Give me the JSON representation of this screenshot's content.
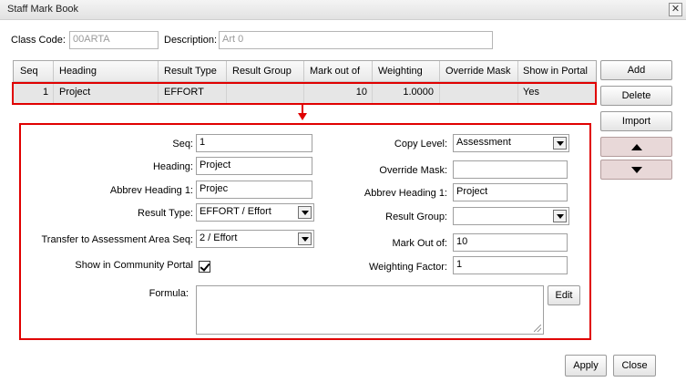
{
  "window": {
    "title": "Staff Mark Book",
    "close_glyph": "✕"
  },
  "header": {
    "class_code_label": "Class Code:",
    "class_code_value": "00ARTA",
    "description_label": "Description:",
    "description_value": "Art 0"
  },
  "grid": {
    "columns": [
      "Seq",
      "Heading",
      "Result Type",
      "Result Group",
      "Mark out of",
      "Weighting",
      "Override Mask",
      "Show in Portal"
    ],
    "rows": [
      {
        "seq": "1",
        "heading": "Project",
        "result_type": "EFFORT",
        "result_group": "",
        "mark_out_of": "10",
        "weighting": "1.0000",
        "override_mask": "",
        "show_in_portal": "Yes"
      }
    ]
  },
  "side_buttons": {
    "add": "Add",
    "delete": "Delete",
    "import": "Import",
    "move_up_icon": "up-arrow-icon",
    "move_down_icon": "down-arrow-icon"
  },
  "form": {
    "seq_label": "Seq:",
    "seq_value": "1",
    "heading_label": "Heading:",
    "heading_value": "Project",
    "abbrev_label": "Abbrev Heading 1:",
    "abbrev_value": "Projec",
    "result_type_label": "Result Type:",
    "result_type_value": "EFFORT / Effort",
    "transfer_label": "Transfer to Assessment Area Seq:",
    "transfer_value": "2 / Effort",
    "portal_label": "Show in Community Portal",
    "portal_checked": true,
    "formula_label": "Formula:",
    "formula_value": "",
    "edit_label": "Edit",
    "copy_level_label": "Copy Level:",
    "copy_level_value": "Assessment",
    "override_mask_label": "Override Mask:",
    "override_mask_value": "",
    "abbrev2_label": "Abbrev Heading 1:",
    "abbrev2_value": "Project",
    "result_group_label": "Result Group:",
    "result_group_value": "",
    "mark_out_of_label": "Mark Out of:",
    "mark_out_of_value": "10",
    "weighting_label": "Weighting Factor:",
    "weighting_value": "1"
  },
  "footer": {
    "apply": "Apply",
    "close": "Close"
  },
  "colors": {
    "highlight": "#e00000",
    "selected_row": "#e6e6e6",
    "arrow_button": "#e8d8d8"
  }
}
